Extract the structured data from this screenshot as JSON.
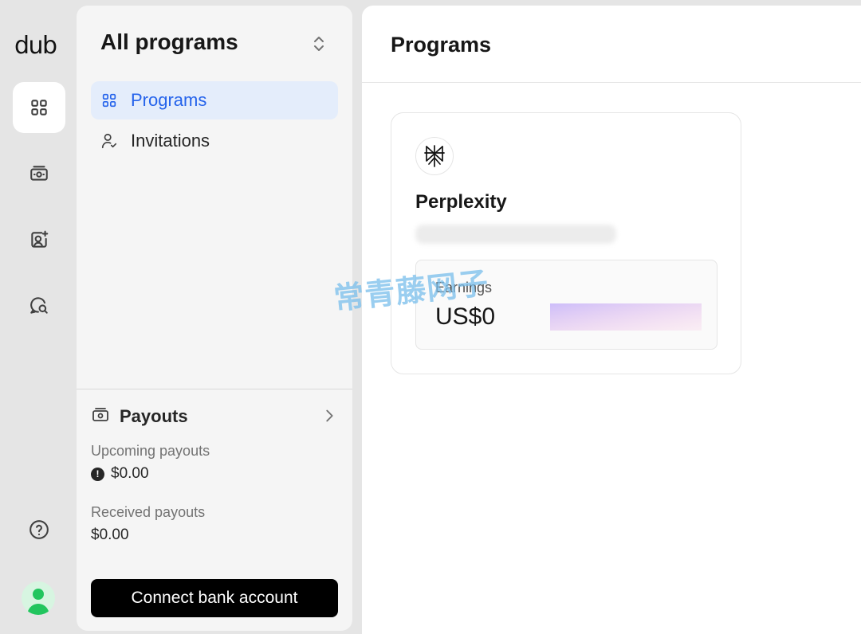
{
  "rail": {
    "logo": "dub",
    "items": [
      {
        "name": "programs-grid-icon",
        "active": true
      },
      {
        "name": "payouts-cash-icon",
        "active": false
      },
      {
        "name": "profile-icon",
        "active": false
      },
      {
        "name": "messages-icon",
        "active": false
      }
    ],
    "help_icon": "help-circle-icon",
    "avatar_color": "#22c55e"
  },
  "panel": {
    "title": "All programs",
    "nav": [
      {
        "label": "Programs",
        "icon": "grid-icon",
        "active": true
      },
      {
        "label": "Invitations",
        "icon": "user-check-icon",
        "active": false
      }
    ],
    "payouts": {
      "title": "Payouts",
      "upcoming_label": "Upcoming payouts",
      "upcoming_value": "$0.00",
      "received_label": "Received payouts",
      "received_value": "$0.00"
    },
    "connect_button": "Connect bank account"
  },
  "main": {
    "title": "Programs",
    "programs": [
      {
        "name": "Perplexity",
        "earnings_label": "Earnings",
        "earnings_value": "US$0"
      }
    ]
  },
  "watermark": "常青藤网子",
  "colors": {
    "accent": "#2563eb",
    "active_bg": "#e4edfb",
    "spark_start": "#8b5cf6",
    "spark_end": "#db2777"
  }
}
